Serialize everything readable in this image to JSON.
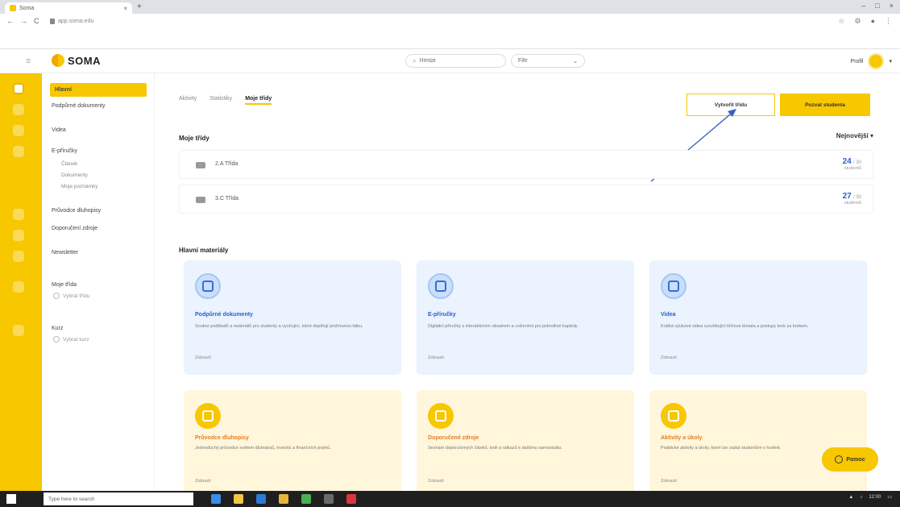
{
  "browser": {
    "tab_title": "Soma",
    "tab_close": "×",
    "new_tab": "+",
    "win_min": "–",
    "win_max": "□",
    "win_close": "×",
    "back": "←",
    "forward": "→",
    "reload": "C",
    "url": "app.soma.edu"
  },
  "app": {
    "brand": "SOMA",
    "search_placeholder": "Hledat",
    "filter_label": "Filtr",
    "filter_caret": "⌄",
    "user_name": "Profil",
    "user_caret": "▾"
  },
  "sidebar": {
    "active": "Hlavní",
    "items": [
      "Podpůrné dokumenty",
      "Videa",
      "E-příručky"
    ],
    "subitems": [
      "Článek",
      "Dokumenty",
      "Moje poznámky"
    ],
    "items2": [
      "Průvodce dluhopisy",
      "Doporučení zdroje",
      "Newsletter"
    ],
    "radio1_title": "Moje třída",
    "radio1_label": "Vybrat třídu",
    "radio2_title": "Kurz",
    "radio2_label": "Vybrat kurz"
  },
  "main": {
    "tabs": [
      "Aktivity",
      "Statistiky",
      "Moje třídy"
    ],
    "btn_outline": "Vytvořit třídu",
    "btn_solid": "Pozvat studenta",
    "section1_title": "Moje třídy",
    "sort_label": "Nejnovější ▾",
    "rows": [
      {
        "label": "2.A Třída",
        "value": "24",
        "unit": "/ 30",
        "sub": "studentů"
      },
      {
        "label": "3.C Třída",
        "value": "27",
        "unit": "/ 30",
        "sub": "studentů"
      }
    ],
    "section2_title": "Hlavní materiály",
    "cards_blue": [
      {
        "title": "Podpůrné dokumenty",
        "desc": "Soubor podkladů a materiálů pro studenty a vyučující, které doplňují probíranou látku.",
        "meta": "Zobrazit"
      },
      {
        "title": "E-příručky",
        "desc": "Digitální příručky s interaktivním obsahem a cvičeními pro jednotlivé kapitoly.",
        "meta": "Zobrazit"
      },
      {
        "title": "Videa",
        "desc": "Krátká výuková videa vysvětlující klíčová témata a postupy krok za krokem.",
        "meta": "Zobrazit"
      }
    ],
    "cards_yellow": [
      {
        "title": "Průvodce dluhopisy",
        "desc": "Jednoduchý průvodce světem dluhopisů, investic a finančních pojmů.",
        "meta": "Zobrazit"
      },
      {
        "title": "Doporučené zdroje",
        "desc": "Seznam doporučených článků, knih a odkazů k dalšímu samostudiu.",
        "meta": "Zobrazit"
      },
      {
        "title": "Aktivity a úkoly",
        "desc": "Praktické aktivity a úkoly, které lze zadat studentům v hodině.",
        "meta": "Zobrazit"
      }
    ],
    "help_label": "Pomoc"
  },
  "taskbar": {
    "search_placeholder": "Type here to search",
    "time": "12:00"
  }
}
